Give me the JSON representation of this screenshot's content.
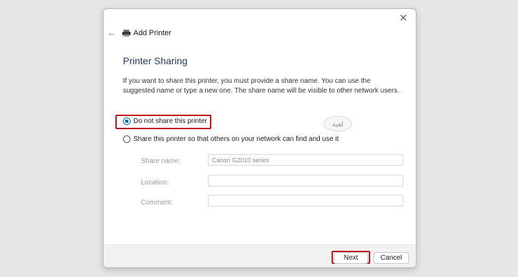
{
  "window": {
    "title": "Add Printer",
    "close_glyph": "✕",
    "back_glyph": "←"
  },
  "page": {
    "heading": "Printer Sharing",
    "description": "If you want to share this printer, you must provide a share name. You can use the suggested name or type a new one. The share name will be visible to other network users."
  },
  "options": [
    {
      "label": "Do not share this printer",
      "selected": true
    },
    {
      "label": "Share this printer so that others on your network can find and use it",
      "selected": false
    }
  ],
  "fields": {
    "share_name": {
      "label": "Share name:",
      "value": "Canon G2010 series"
    },
    "location": {
      "label": "Location:",
      "value": ""
    },
    "comment": {
      "label": "Comment:",
      "value": ""
    }
  },
  "buttons": {
    "next": "Next",
    "cancel": "Cancel"
  },
  "watermark": {
    "text": "لعبة"
  },
  "colors": {
    "accent": "#0063b1",
    "highlight": "#c0141c",
    "heading": "#1e3a5f"
  },
  "icons": {
    "back": "arrow-left-icon",
    "title": "printer-icon",
    "close": "close-icon"
  }
}
